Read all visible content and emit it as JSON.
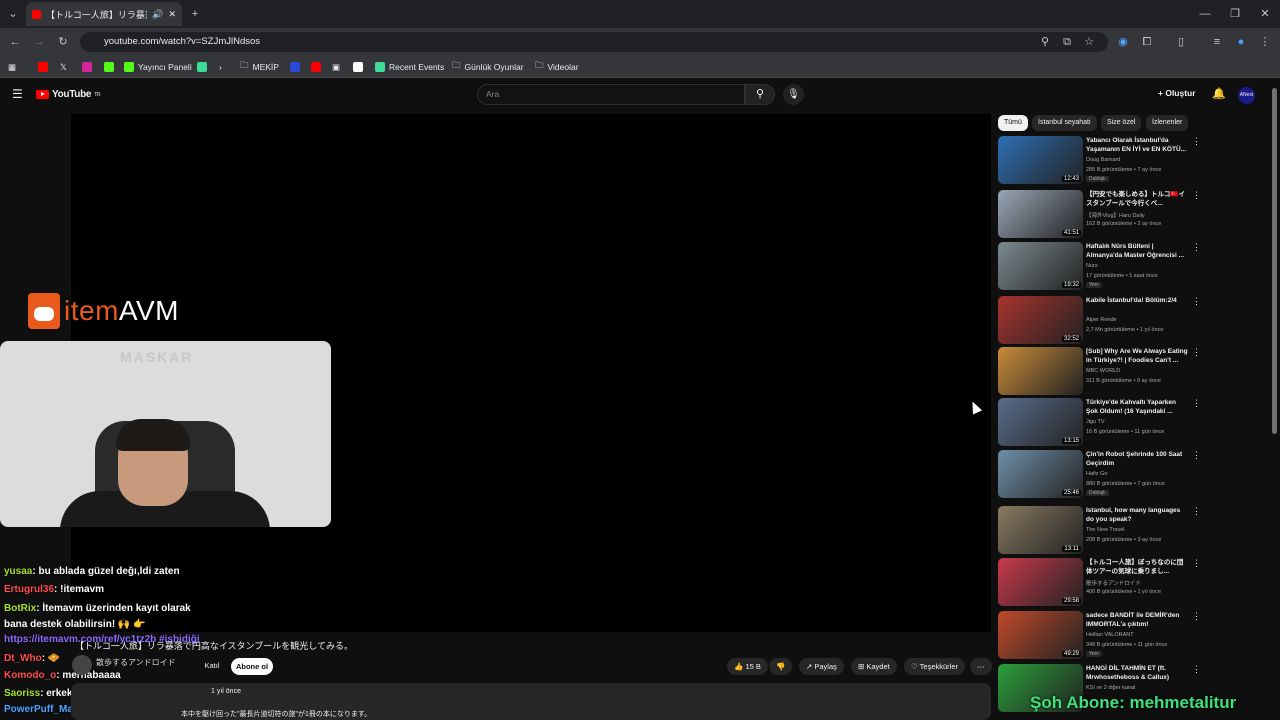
{
  "browser": {
    "tab_title": "【トルコ一人旅】リラ暴落で円高",
    "url": "youtube.com/watch?v=SZJmJlNdsos",
    "bookmarks": [
      "Yayıncı Paneli",
      "MEKİP",
      "Recent Events",
      "Günlük Oyunlar",
      "Videolar"
    ]
  },
  "youtube": {
    "logo": "YouTube",
    "logo_region": "TR",
    "search_placeholder": "Ara",
    "create_label": "Oluştur",
    "avatar_label": "ANext"
  },
  "video": {
    "title": "【トルコ一人旅】リラ暴落で円高なイスタンブールを観光してみる。",
    "channel": "散歩するアンドロイド",
    "join_label": "Katıl",
    "subscribe_label": "Abone ol",
    "likes": "15 B",
    "share_label": "Paylaş",
    "save_label": "Kaydet",
    "thanks_label": "Teşekkürler",
    "desc_age": "1 yıl önce",
    "desc_text": "本中を駆け回った\"最長片道切符の旅\"が1冊の本になります。"
  },
  "overlay": {
    "brand_prefix": "item",
    "brand_suffix": "AVM",
    "cam_wall_text": "MASKAR",
    "promo_text": "Şoh Abone: mehmetalitur"
  },
  "chat": [
    {
      "user": "yusaa",
      "text": ": bu ablada güzel değı,ldi zaten",
      "color": "#a6e22e"
    },
    {
      "user": "Ertugrul36",
      "text": ": !itemavm",
      "color": "#ff4d4d"
    },
    {
      "user": "BotRix",
      "text": ": İtemavm üzerinden kayıt olarak",
      "color": "#a6e22e"
    },
    {
      "user": "",
      "text": "bana destek olabilirsin! 🙌 👉",
      "color": "#fff"
    },
    {
      "user": "",
      "text": "https://itemavm.com/ref/yc1tz2b #ishidiği",
      "color": "#8d6bff"
    },
    {
      "user": "Dt_Who",
      "text": ": 🧇",
      "color": "#ff4d4d"
    },
    {
      "user": "Komodo_o",
      "text": ": merhabaaaa",
      "color": "#ff4d4d"
    },
    {
      "user": "Saoriss",
      "text": ": erkek(şüpheli)",
      "color": "#a6e22e"
    },
    {
      "user": "PowerPuff_Man",
      "text": "",
      "color": "#4da3ff"
    }
  ],
  "chips": [
    "Tümü",
    "İstanbul seyahati",
    "Size özel",
    "İzlenenler"
  ],
  "recommendations": [
    {
      "title": "Yabancı Olarak İstanbul'da Yaşamanın EN İYİ ve EN KÖTÜ...",
      "channel": "Doug Barnard",
      "meta": "285 B görüntüleme • 7 ay önce",
      "badge": "Dublajlı",
      "duration": "12:43",
      "color": "#2e6fb5"
    },
    {
      "title": "【円安でも楽しめる】トルコ🇹🇷イスタンブールで今行くべ...",
      "channel": "【海外Vlog】Haru Daily",
      "meta": "162 B görüntüleme • 2 ay önce",
      "badge": "",
      "duration": "41:51",
      "color": "#9aa7b8"
    },
    {
      "title": "Haftalık Nürs Bülteni | Almanya'da Master Öğrencisi ...",
      "channel": "Nurs",
      "meta": "17 görüntüleme • 1 saat önce",
      "badge": "Yeni",
      "duration": "19:32",
      "color": "#7d8a8f"
    },
    {
      "title": "Kabile İstanbul'da! Bölüm:2/4",
      "channel": "Alper Rende",
      "meta": "2,7 Mn görüntüleme • 1 yıl önce",
      "badge": "",
      "duration": "32:52",
      "color": "#a8332e"
    },
    {
      "title": "[Sub] Why Are We Always Eating in Türkiye?! | Foodies Can't ...",
      "channel": "MBC WORLD",
      "meta": "311 B görüntüleme • 9 ay önce",
      "badge": "",
      "duration": "",
      "color": "#c98b3a"
    },
    {
      "title": "Türkiye'de Kahvaltı Yaparken Şok Oldum! (16 Yaşındaki ...",
      "channel": "Jigu TV",
      "meta": "16 B görüntüleme • 11 gün önce",
      "badge": "",
      "duration": "13:15",
      "color": "#5a6d8c"
    },
    {
      "title": "Çin'in Robot Şehrinde 100 Saat Geçirdim",
      "channel": "Hafiz Go",
      "meta": "880 B görüntüleme • 7 gün önce",
      "badge": "Dublajlı",
      "duration": "25:46",
      "color": "#6f8fa8"
    },
    {
      "title": "Istanbul, how many languages do you speak?",
      "channel": "The New Travel",
      "meta": "208 B görüntüleme • 3 ay önce",
      "badge": "",
      "duration": "13:11",
      "color": "#8a7a62"
    },
    {
      "title": "【トルコ一人旅】ぼっちなのに団体ツアーの気球に乗りまし...",
      "channel": "散歩するアンドロイド",
      "meta": "400 B görüntüleme • 1 yıl önce",
      "badge": "",
      "duration": "29:58",
      "color": "#c83a4c"
    },
    {
      "title": "sadece BANDİT ile DEMİR'den IMMORTAL'a çıktım!",
      "channel": "Hellian VALORANT",
      "meta": "348 B görüntüleme • 11 gün önce",
      "badge": "Yeni",
      "duration": "49:29",
      "color": "#c04a2a"
    },
    {
      "title": "HANGİ DİL TAHMİN ET (ft. Mrwhosetheboss & Callux)",
      "channel": "KSI ve 2 diğer kanal",
      "meta": "",
      "badge": "",
      "duration": "",
      "color": "#2b9e3a"
    }
  ]
}
